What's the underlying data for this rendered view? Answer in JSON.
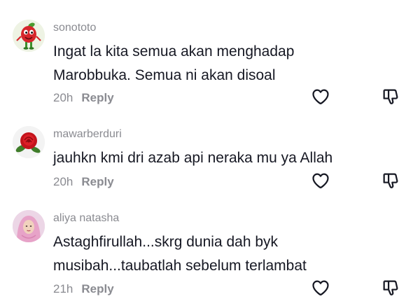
{
  "comments": [
    {
      "username": "sonototo",
      "text": "Ingat la kita semua akan menghadap Marobbuka. Semua ni akan disoal",
      "time": "20h",
      "reply_label": "Reply"
    },
    {
      "username": "mawarberduri",
      "text": "jauhkn kmi dri azab api neraka mu ya Allah",
      "time": "20h",
      "reply_label": "Reply"
    },
    {
      "username": "aliya natasha",
      "text": "Astaghfirullah...skrg dunia dah byk musibah...taubatlah sebelum terlambat",
      "time": "21h",
      "reply_label": "Reply"
    }
  ],
  "icons": {
    "like": "heart-icon",
    "dislike": "thumbs-down-icon"
  },
  "colors": {
    "username": "#8a8b91",
    "text": "#161823",
    "meta": "#8a8b91",
    "icon": "#161823"
  }
}
